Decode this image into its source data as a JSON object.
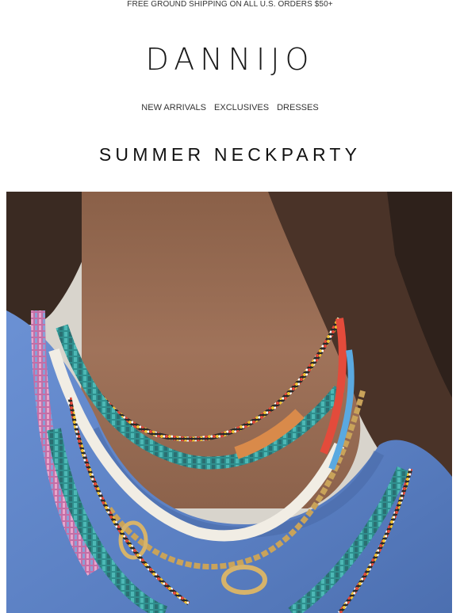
{
  "banner": {
    "text": "FREE GROUND SHIPPING ON ALL U.S. ORDERS $50+"
  },
  "brand": {
    "logo": "DANNIJO"
  },
  "nav": {
    "items": [
      {
        "label": "NEW ARRIVALS"
      },
      {
        "label": "EXCLUSIVES"
      },
      {
        "label": "DRESSES"
      }
    ]
  },
  "hero": {
    "headline": "SUMMER NECKPARTY"
  },
  "colors": {
    "skin": "#9a6e55",
    "hair": "#3a2a22",
    "shirt": "#5f83c8",
    "turquoise": "#3fa7a6",
    "gold": "#c9a35a"
  }
}
